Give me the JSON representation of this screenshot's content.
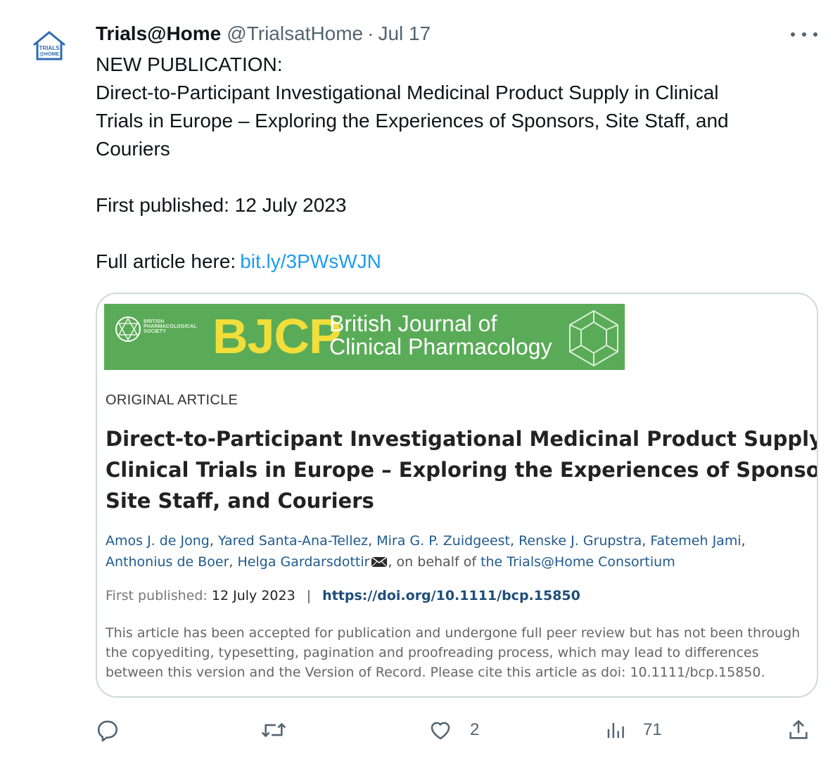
{
  "tweet": {
    "author_name": "Trials@Home",
    "handle": "@TrialsatHome",
    "separator": "·",
    "date": "Jul 17",
    "avatar_text_line1": "TRIALS",
    "avatar_text_line2": "@HOME",
    "lines": [
      "NEW PUBLICATION:",
      "Direct-to-Participant Investigational Medicinal Product Supply in Clinical",
      "Trials in Europe – Exploring the Experiences of Sponsors, Site Staff, and",
      "Couriers",
      "",
      "First published: 12 July 2023",
      ""
    ],
    "link_prefix": "Full article here:",
    "link_text": "bit.ly/3PWsWJN"
  },
  "card": {
    "banner": {
      "society_line1": "BRITISH",
      "society_line2": "PHARMACOLOGICAL",
      "society_line3": "SOCIETY",
      "acronym": "BJCP",
      "journal_line1": "British Journal of",
      "journal_line2": "Clinical Pharmacology"
    },
    "kicker": "ORIGINAL ARTICLE",
    "title_lines": [
      "Direct-to-Participant Investigational Medicinal Product Supply in",
      "Clinical Trials in Europe – Exploring the Experiences of Sponsors,",
      "Site Staff, and Couriers"
    ],
    "authors_line1": [
      "Amos J. de Jong",
      "Yared Santa-Ana-Tellez",
      "Mira G. P. Zuidgeest",
      "Renske J. Grupstra",
      "Fatemeh Jami"
    ],
    "authors_line2": [
      "Anthonius de Boer",
      "Helga Gardarsdottir"
    ],
    "behalf_label": "on behalf of",
    "consortium": "the Trials@Home Consortium",
    "published_label": "First published:",
    "published_date": "12 July 2023",
    "pipe": "|",
    "doi_link": "https://doi.org/10.1111/bcp.15850",
    "notice_lines": [
      "This article has been accepted for publication and undergone full peer review but has not been through",
      "the copyediting, typesetting, pagination and proofreading process, which may lead to differences",
      "between this version and the Version of Record. Please cite this article as doi: 10.1111/bcp.15850."
    ]
  },
  "actions": {
    "reply_icon": "reply-icon",
    "retweet_icon": "retweet-icon",
    "like_icon": "heart-icon",
    "like_count": "2",
    "views_icon": "views-icon",
    "views_count": "71",
    "share_icon": "share-icon"
  },
  "colors": {
    "link": "#1d9bf0",
    "secondary": "#536471",
    "banner_green": "#5aab57",
    "bjcp_yellow": "#f1de3a",
    "author_blue": "#1f5a8e"
  }
}
